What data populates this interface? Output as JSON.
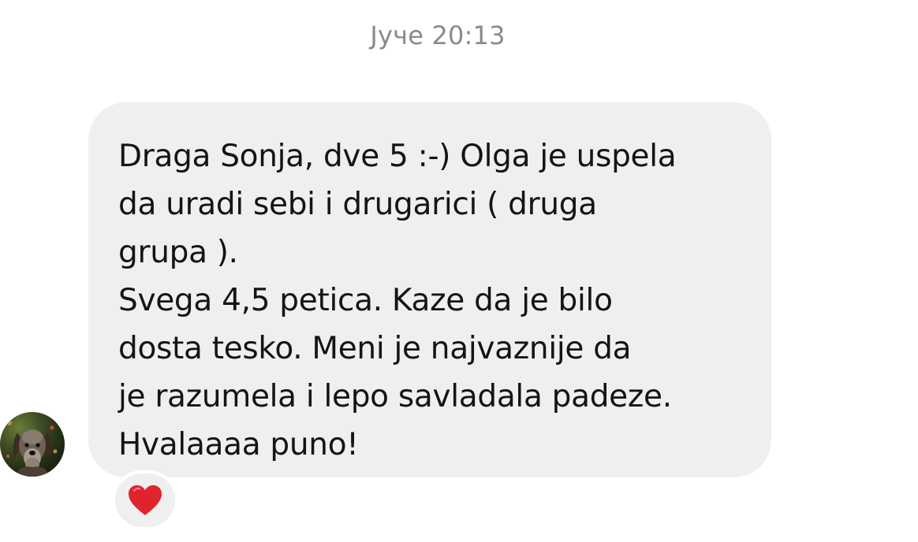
{
  "timestamp": "Јуче 20:13",
  "message": {
    "lines": [
      "Draga Sonja, dve 5 :-) Olga je uspela",
      "da uradi sebi i drugarici ( druga",
      "grupa ).",
      "Svega 4,5 petica. Kaze da je bilo",
      "dosta tesko. Meni je najvaznije da",
      "je razumela i lepo savladala padeze.",
      "Hvalaaaa puno!"
    ]
  },
  "reaction": {
    "icon": "red-heart-icon",
    "color": "#e0242e"
  },
  "colors": {
    "bubble": "#efefef",
    "timestamp": "#8a8a8a",
    "text": "#141414"
  }
}
